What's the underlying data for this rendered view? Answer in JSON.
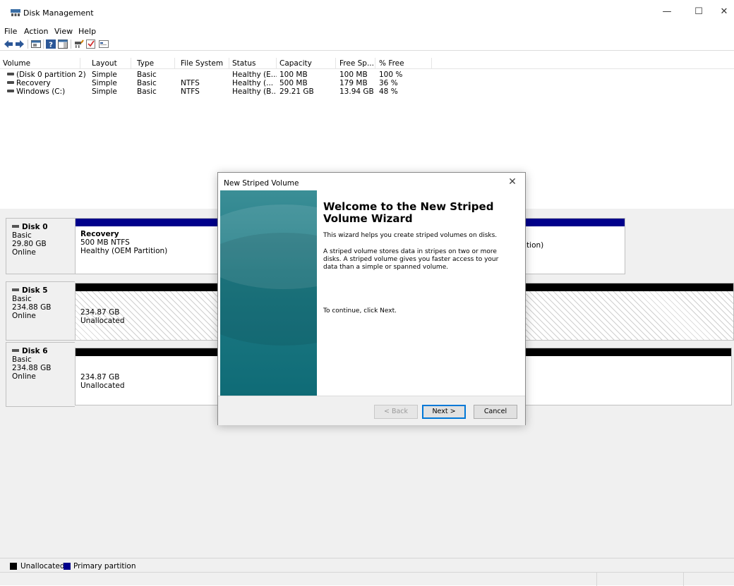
{
  "window": {
    "title": "Disk Management",
    "minimize": "—",
    "maximize": "☐",
    "close": "✕"
  },
  "menu": [
    "File",
    "Action",
    "View",
    "Help"
  ],
  "volume_list": {
    "columns": [
      "Volume",
      "Layout",
      "Type",
      "File System",
      "Status",
      "Capacity",
      "Free Sp...",
      "% Free"
    ],
    "rows": [
      [
        "(Disk 0 partition 2)",
        "Simple",
        "Basic",
        "",
        "Healthy (E...",
        "100 MB",
        "100 MB",
        "100 %"
      ],
      [
        "Recovery",
        "Simple",
        "Basic",
        "NTFS",
        "Healthy (...",
        "500 MB",
        "179 MB",
        "36 %"
      ],
      [
        "Windows (C:)",
        "Simple",
        "Basic",
        "NTFS",
        "Healthy (B...",
        "29.21 GB",
        "13.94 GB",
        "48 %"
      ]
    ]
  },
  "disks": [
    {
      "name": "Disk 0",
      "type": "Basic",
      "size": "29.80 GB",
      "state": "Online",
      "partition": {
        "title": "Recovery",
        "line1": "500 MB NTFS",
        "line2": "Healthy (OEM Partition)",
        "right_text": "tition)"
      }
    },
    {
      "name": "Disk 5",
      "type": "Basic",
      "size": "234.88 GB",
      "state": "Online",
      "partition": {
        "line1": "234.87 GB",
        "line2": "Unallocated"
      }
    },
    {
      "name": "Disk 6",
      "type": "Basic",
      "size": "234.88 GB",
      "state": "Online",
      "partition": {
        "line1": "234.87 GB",
        "line2": "Unallocated"
      }
    }
  ],
  "legend": [
    {
      "label": "Unallocated",
      "color": "#000000"
    },
    {
      "label": "Primary partition",
      "color": "#00008b"
    }
  ],
  "dialog": {
    "title": "New Striped Volume",
    "close": "✕",
    "heading": "Welcome to the New Striped Volume Wizard",
    "para1": "This wizard helps you create striped volumes on disks.",
    "para2": "A striped volume stores data in stripes on two or more disks. A striped volume gives you faster access to your data than a simple or spanned volume.",
    "para3": "To continue, click Next.",
    "buttons": {
      "back": "< Back",
      "next": "Next >",
      "cancel": "Cancel"
    }
  }
}
